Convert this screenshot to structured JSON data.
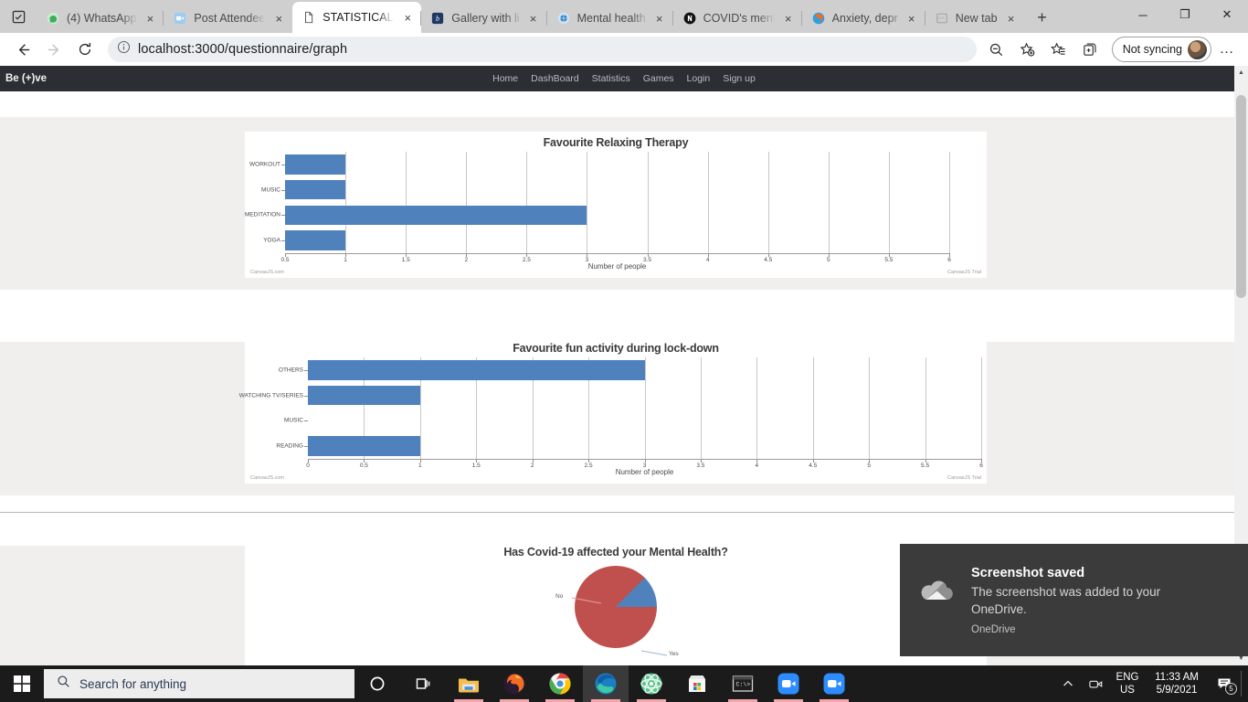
{
  "browser": {
    "tabs": [
      {
        "label": "(4) WhatsApp",
        "icon": "whatsapp-icon",
        "active": false
      },
      {
        "label": "Post Attendee",
        "icon": "zoom-icon",
        "active": false
      },
      {
        "label": "STATISTICAL A",
        "icon": "document-icon",
        "active": true
      },
      {
        "label": "Gallery with li",
        "icon": "bootstrap-icon",
        "active": false
      },
      {
        "label": "Mental health",
        "icon": "who-icon",
        "active": false
      },
      {
        "label": "COVID's ment",
        "icon": "nature-icon",
        "active": false
      },
      {
        "label": "Anxiety, depr",
        "icon": "firefox-icon",
        "active": false
      },
      {
        "label": "New tab",
        "icon": "newtab-icon",
        "active": false
      }
    ],
    "new_tab_label": "+",
    "close_label": "×",
    "window_controls": {
      "minimize": "─",
      "maximize": "❐",
      "close": "✕"
    },
    "toolbar": {
      "back": "back-arrow",
      "forward": "forward-arrow",
      "reload": "reload-icon",
      "info": "info-icon",
      "url": "localhost:3000/questionnaire/graph",
      "url_host": "localhost:3000",
      "url_path": "/questionnaire/graph",
      "zoom_out_icon": "zoom-out-icon",
      "favorite_icon": "add-favorite-icon",
      "collections_icon": "collections-icon",
      "favorites_bar_icon": "favorites-icon",
      "sync_label": "Not syncing",
      "settings_label": "…"
    }
  },
  "site": {
    "brand": "Be (+)ve",
    "nav": [
      {
        "label": "Home"
      },
      {
        "label": "DashBoard"
      },
      {
        "label": "Statistics"
      },
      {
        "label": "Games"
      },
      {
        "label": "Login"
      },
      {
        "label": "Sign up"
      }
    ]
  },
  "chart_data": [
    {
      "type": "bar",
      "orientation": "horizontal",
      "title": "Favourite Relaxing Therapy",
      "categories": [
        "WORKOUT",
        "MUSIC",
        "MEDITATION",
        "YOGA"
      ],
      "values": [
        1,
        1,
        3,
        1
      ],
      "xlabel": "Number of people",
      "ylabel": "",
      "xlim": [
        0.5,
        6
      ],
      "xticks": [
        "0.5",
        "1",
        "1.5",
        "2",
        "2.5",
        "3",
        "3.5",
        "4",
        "4.5",
        "5",
        "5.5",
        "6"
      ],
      "grid": true,
      "legend": "none",
      "bar_color": "#4f81bd",
      "credit_left": "CanvasJS.com",
      "credit_right": "CanvasJS Trial"
    },
    {
      "type": "bar",
      "orientation": "horizontal",
      "title": "Favourite fun activity during lock-down",
      "categories": [
        "OTHERS",
        "WATCHING TV/SERIES",
        "MUSIC",
        "READING"
      ],
      "values": [
        3,
        1,
        0,
        1
      ],
      "xlabel": "Number of people",
      "ylabel": "",
      "xlim": [
        0,
        6
      ],
      "xticks": [
        "0",
        "0.5",
        "1",
        "1.5",
        "2",
        "2.5",
        "3",
        "3.5",
        "4",
        "4.5",
        "5",
        "5.5",
        "6"
      ],
      "grid": true,
      "legend": "none",
      "bar_color": "#4f81bd",
      "credit_left": "CanvasJS.com",
      "credit_right": "CanvasJS Trial"
    },
    {
      "type": "pie",
      "title": "Has Covid-19 affected your Mental Health?",
      "labels": [
        "No",
        "Yes"
      ],
      "values": [
        87.5,
        12.5
      ],
      "colors": [
        "#c0504d",
        "#4f81bd"
      ],
      "legend": "none"
    }
  ],
  "scrollbar": {
    "up_arrow": "▲",
    "down_arrow": "▼"
  },
  "toast": {
    "icon": "onedrive-cloud-icon",
    "title": "Screenshot saved",
    "body": "The screenshot was added to your OneDrive.",
    "app": "OneDrive"
  },
  "taskbar": {
    "start_label": "start-icon",
    "search_placeholder": "Search for anything",
    "cortana_label": "cortana-icon",
    "taskview_label": "task-view-icon",
    "apps": [
      {
        "name": "file-explorer",
        "running": true
      },
      {
        "name": "firefox",
        "running": true
      },
      {
        "name": "chrome",
        "running": true
      },
      {
        "name": "microsoft-edge",
        "running": true,
        "active": true
      },
      {
        "name": "atom-editor",
        "running": true
      },
      {
        "name": "microsoft-store",
        "running": false
      },
      {
        "name": "command-prompt",
        "running": true
      },
      {
        "name": "zoom-meetings",
        "running": true
      },
      {
        "name": "zoom-rooms",
        "running": true
      }
    ],
    "tray": {
      "show_hidden": "ⱏ",
      "meet_now": "meet-now-icon",
      "lang_line1": "ENG",
      "lang_line2": "US",
      "time": "11:33 AM",
      "date": "5/9/2021",
      "notification_count": "5"
    }
  }
}
